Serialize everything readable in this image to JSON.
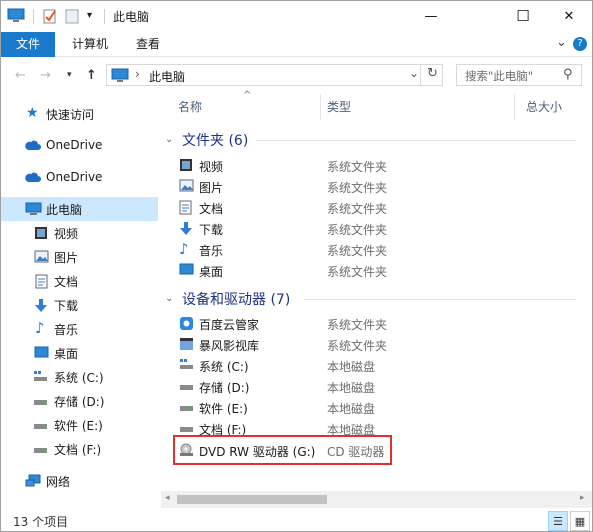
{
  "window": {
    "title": "此电脑",
    "minimize_glyph": "—",
    "maximize_glyph": "☐",
    "close_glyph": "✕"
  },
  "ribbon": {
    "tabs": [
      "文件",
      "计算机",
      "查看"
    ],
    "collapse_glyph": "⌄",
    "help_glyph": "?"
  },
  "address": {
    "path_sep": "›",
    "location": "此电脑",
    "search_placeholder": "搜索\"此电脑\"",
    "dropdown_glyph": "⌄",
    "refresh_glyph": "↻",
    "search_glyph": "⚲"
  },
  "nav": {
    "items": [
      {
        "label": "快速访问",
        "icon": "star-icon"
      },
      {
        "label": "OneDrive",
        "icon": "cloud-icon"
      },
      {
        "label": "OneDrive",
        "icon": "cloud-icon"
      },
      {
        "label": "此电脑",
        "icon": "pc-icon",
        "selected": true
      },
      {
        "label": "视频",
        "icon": "video-icon"
      },
      {
        "label": "图片",
        "icon": "pictures-icon"
      },
      {
        "label": "文档",
        "icon": "documents-icon"
      },
      {
        "label": "下载",
        "icon": "download-icon"
      },
      {
        "label": "音乐",
        "icon": "music-icon"
      },
      {
        "label": "桌面",
        "icon": "desktop-icon"
      },
      {
        "label": "系统 (C:)",
        "icon": "system-drive-icon"
      },
      {
        "label": "存储 (D:)",
        "icon": "drive-icon"
      },
      {
        "label": "软件 (E:)",
        "icon": "drive-icon"
      },
      {
        "label": "文档 (F:)",
        "icon": "drive-icon"
      },
      {
        "label": "网络",
        "icon": "network-icon"
      }
    ]
  },
  "columns": {
    "name": "名称",
    "type": "类型",
    "size": "总大小",
    "sort_glyph": "^"
  },
  "groups": {
    "folders": {
      "title": "文件夹 (6)",
      "items": [
        {
          "name": "视频",
          "type": "系统文件夹",
          "icon": "video-icon"
        },
        {
          "name": "图片",
          "type": "系统文件夹",
          "icon": "pictures-icon"
        },
        {
          "name": "文档",
          "type": "系统文件夹",
          "icon": "documents-icon"
        },
        {
          "name": "下载",
          "type": "系统文件夹",
          "icon": "download-icon"
        },
        {
          "name": "音乐",
          "type": "系统文件夹",
          "icon": "music-icon"
        },
        {
          "name": "桌面",
          "type": "系统文件夹",
          "icon": "desktop-icon"
        }
      ]
    },
    "devices": {
      "title": "设备和驱动器 (7)",
      "items": [
        {
          "name": "百度云管家",
          "type": "系统文件夹",
          "icon": "baidu-cloud-icon"
        },
        {
          "name": "暴风影视库",
          "type": "系统文件夹",
          "icon": "video-library-icon"
        },
        {
          "name": "系统 (C:)",
          "type": "本地磁盘",
          "icon": "system-drive-icon"
        },
        {
          "name": "存储 (D:)",
          "type": "本地磁盘",
          "icon": "drive-icon"
        },
        {
          "name": "软件 (E:)",
          "type": "本地磁盘",
          "icon": "drive-icon"
        },
        {
          "name": "文档 (F:)",
          "type": "本地磁盘",
          "icon": "drive-icon"
        },
        {
          "name": "DVD RW 驱动器 (G:)",
          "type": "CD 驱动器",
          "icon": "dvd-drive-icon"
        }
      ]
    }
  },
  "status": {
    "count": "13 个项目"
  },
  "colors": {
    "accent": "#1979ca",
    "selection": "#cce8ff",
    "group_title": "#1e3287",
    "highlight_box": "#e32f2f"
  }
}
